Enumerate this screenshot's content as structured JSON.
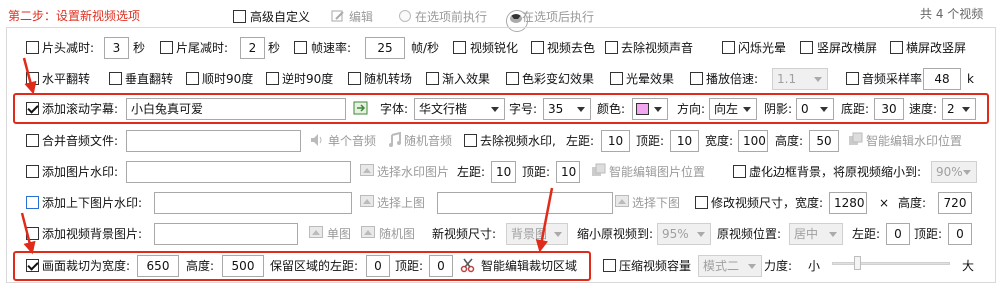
{
  "header": {
    "step_title": "第二步：设置新视频选项",
    "advanced_label": "高级自定义",
    "edit_label": "编辑",
    "before_label": "在选项前执行",
    "after_label": "在选项后执行",
    "count_text": "共 4 个视频"
  },
  "row1": {
    "head_cut_label": "片头减时:",
    "head_cut_value": "3",
    "sec1": "秒",
    "tail_cut_label": "片尾减时:",
    "tail_cut_value": "2",
    "sec2": "秒",
    "fps_label": "帧速率:",
    "fps_value": "25",
    "fps_unit": "帧/秒",
    "sharpen_label": "视频锐化",
    "decolor_label": "视频去色",
    "mute_label": "去除视频声音",
    "flash_label": "闪烁光晕",
    "v2h_label": "竖屏改横屏",
    "h2v_label": "横屏改竖屏"
  },
  "row2": {
    "hflip_label": "水平翻转",
    "vflip_label": "垂直翻转",
    "rot90cw_label": "顺时90度",
    "rot90ccw_label": "逆时90度",
    "random_transition_label": "随机转场",
    "fadein_label": "渐入效果",
    "color_effect_label": "色彩变幻效果",
    "glow_label": "光晕效果",
    "speed_label": "播放倍速:",
    "speed_value": "1.1",
    "samplerate_label": "音频采样率:",
    "samplerate_value": "48",
    "samplerate_unit": "k"
  },
  "subtitle_row": {
    "label": "添加滚动字幕:",
    "text_value": "小白兔真可爱",
    "font_label": "字体:",
    "font_value": "华文行楷(STI",
    "size_label": "字号:",
    "size_value": "35",
    "color_label": "颜色:",
    "color_hex": "#f2a6f0",
    "direction_label": "方向:",
    "direction_value": "向左",
    "shadow_label": "阴影:",
    "shadow_value": "0",
    "bottom_label": "底距:",
    "bottom_value": "30",
    "speed_label": "速度:",
    "speed_value": "2"
  },
  "audio_row": {
    "label": "合并音频文件:",
    "single_label": "单个音频",
    "random_label": "随机音频",
    "remove_wm_label": "去除视频水印,",
    "left_label": "左距:",
    "left_value": "10",
    "top_label": "顶距:",
    "top_value": "10",
    "width_label": "宽度:",
    "width_value": "100",
    "height_label": "高度:",
    "height_value": "50",
    "smart_wm_label": "智能编辑水印位置"
  },
  "image_row": {
    "label": "添加图片水印:",
    "choose_label": "选择水印图片",
    "left_label": "左距:",
    "left_value": "10",
    "top_label": "顶距:",
    "top_value": "10",
    "smart_label": "智能编辑图片位置",
    "blur_label": "虚化边框背景，将原视频缩小到:",
    "blur_value": "90%"
  },
  "updown_row": {
    "label": "添加上下图片水印:",
    "choose_top_label": "选择上图",
    "choose_bottom_label": "选择下图",
    "resize_label": "修改视频尺寸，宽度:",
    "resize_width": "1280",
    "times": "×",
    "height_label": "高度:",
    "resize_height": "720"
  },
  "bg_row": {
    "label": "添加视频背景图片:",
    "single_label": "单图",
    "random_label": "随机图",
    "newsize_label": "新视频尺寸:",
    "newsize_value": "背景图",
    "shrink_label": "缩小原视频到:",
    "shrink_value": "95%",
    "pos_label": "原视频位置:",
    "pos_value": "居中",
    "left_label": "左距:",
    "left_value": "0",
    "top_label": "顶距:",
    "top_value": "0"
  },
  "crop_row": {
    "label": "画面裁切为宽度:",
    "width_value": "650",
    "height_label": "高度:",
    "height_value": "500",
    "keep_label": "保留区域的左距:",
    "left_value": "0",
    "top_label": "顶距:",
    "top_value": "0",
    "smart_label": "智能编辑裁切区域",
    "compress_label": "压缩视频容量",
    "mode_value": "模式二",
    "strength_label": "力度:",
    "small_label": "小",
    "large_label": "大",
    "strength_level": 0.2
  }
}
